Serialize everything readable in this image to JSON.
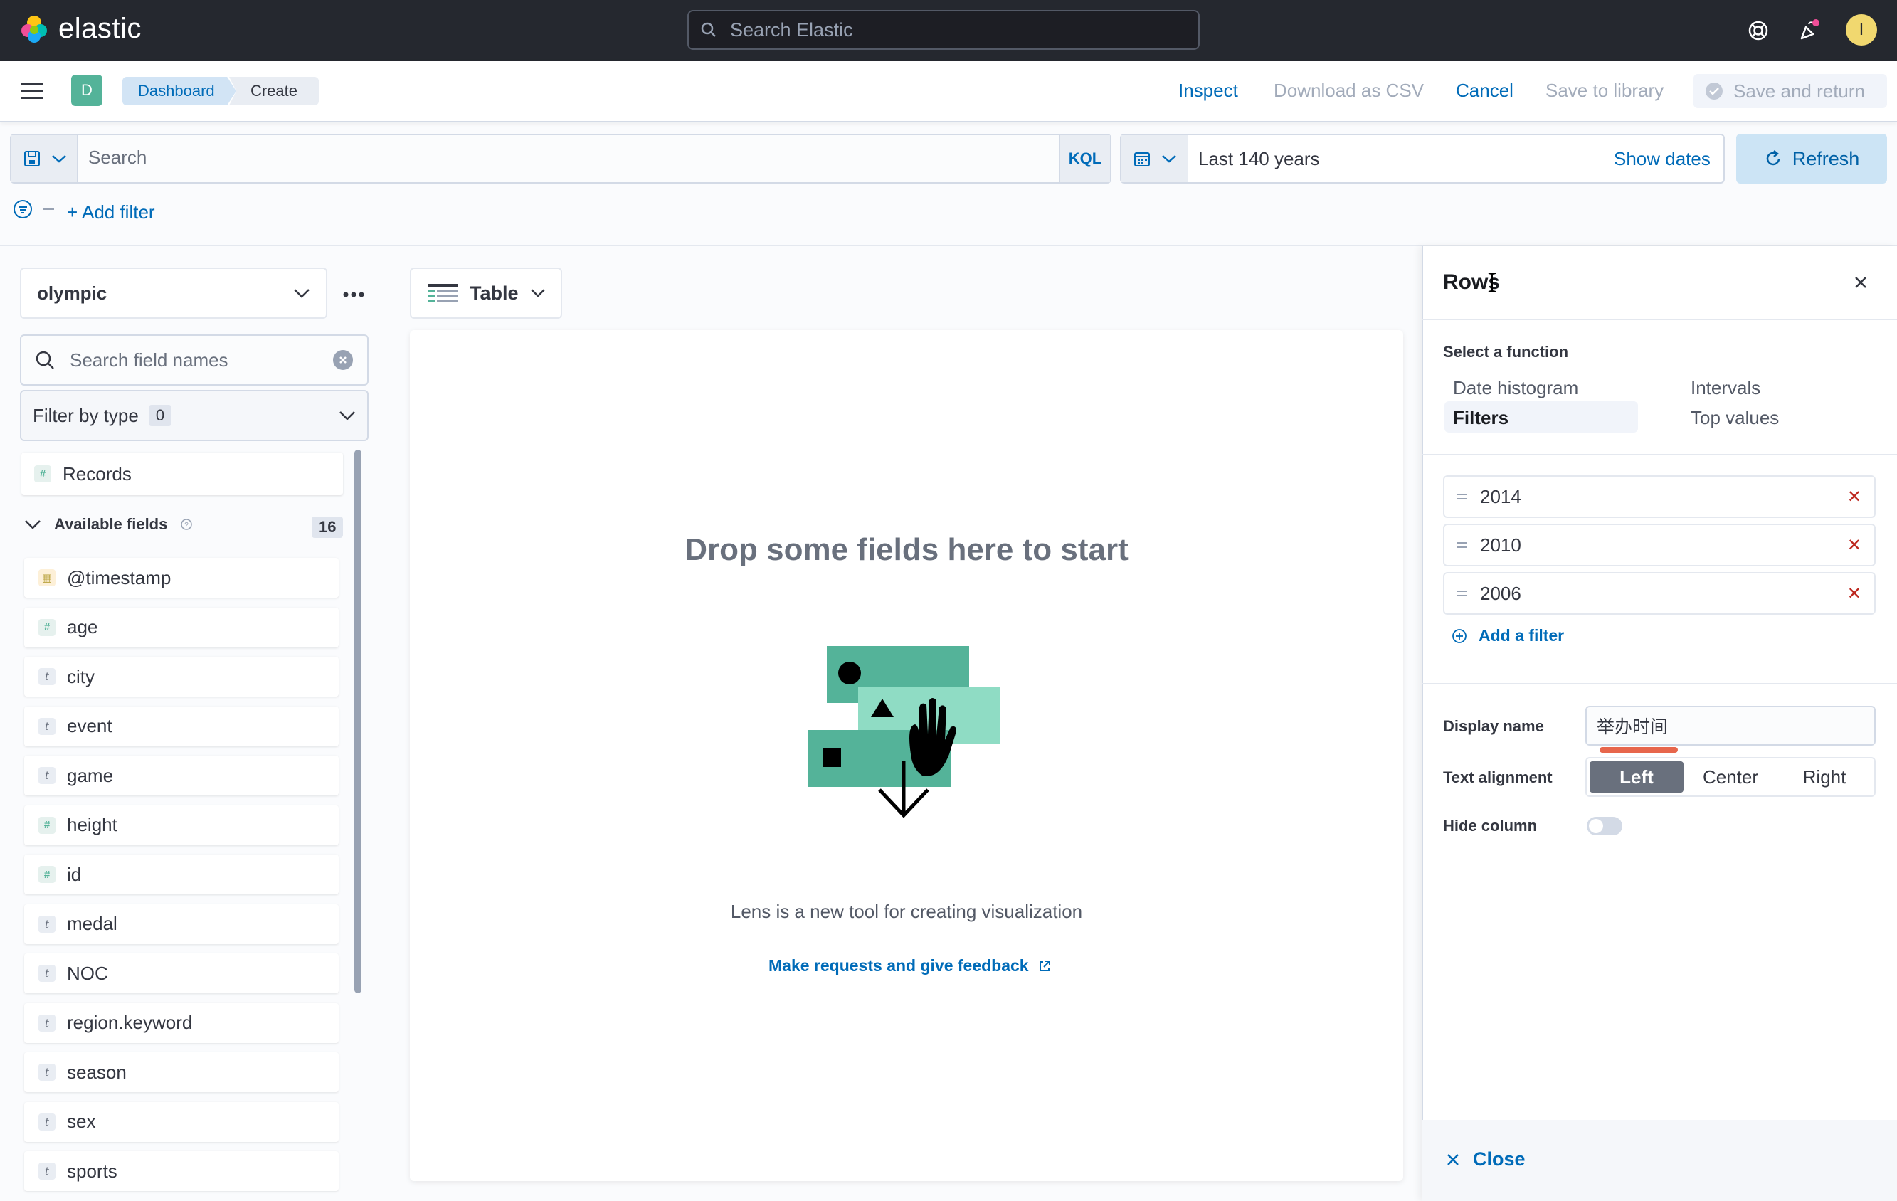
{
  "header": {
    "brand": "elastic",
    "search_placeholder": "Search Elastic",
    "avatar_initial": "I"
  },
  "appbar": {
    "space_badge": "D",
    "breadcrumbs": [
      "Dashboard",
      "Create"
    ],
    "actions": {
      "inspect": "Inspect",
      "download_csv": "Download as CSV",
      "cancel": "Cancel",
      "save_library": "Save to library",
      "save_return": "Save and return"
    }
  },
  "querybar": {
    "search_placeholder": "Search",
    "language": "KQL",
    "time_range": "Last 140 years",
    "show_dates": "Show dates",
    "refresh": "Refresh",
    "add_filter": "+ Add filter"
  },
  "sidebar": {
    "index_pattern": "olympic",
    "field_search_placeholder": "Search field names",
    "filter_by_type": "Filter by type",
    "filter_count": "0",
    "records_label": "Records",
    "available_fields_label": "Available fields",
    "available_count": "16",
    "fields": [
      {
        "name": "@timestamp",
        "type": "date"
      },
      {
        "name": "age",
        "type": "number"
      },
      {
        "name": "city",
        "type": "string"
      },
      {
        "name": "event",
        "type": "string"
      },
      {
        "name": "game",
        "type": "string"
      },
      {
        "name": "height",
        "type": "number"
      },
      {
        "name": "id",
        "type": "number"
      },
      {
        "name": "medal",
        "type": "string"
      },
      {
        "name": "NOC",
        "type": "string"
      },
      {
        "name": "region.keyword",
        "type": "string"
      },
      {
        "name": "season",
        "type": "string"
      },
      {
        "name": "sex",
        "type": "string"
      },
      {
        "name": "sports",
        "type": "string"
      }
    ]
  },
  "workspace": {
    "vis_type": "Table",
    "drop_title": "Drop some fields here to start",
    "description": "Lens is a new tool for creating visualization",
    "feedback_link": "Make requests and give feedback"
  },
  "flyout": {
    "title": "Rows",
    "select_function_label": "Select a function",
    "functions": [
      "Date histogram",
      "Intervals",
      "Filters",
      "Top values"
    ],
    "selected_function": "Filters",
    "filters": [
      "2014",
      "2010",
      "2006"
    ],
    "add_filter": "Add a filter",
    "display_name_label": "Display name",
    "display_name_value": "举办时间",
    "text_alignment_label": "Text alignment",
    "alignment_options": [
      "Left",
      "Center",
      "Right"
    ],
    "alignment_selected": "Left",
    "hide_column_label": "Hide column",
    "hide_column_on": false,
    "close": "Close"
  },
  "colors": {
    "header_bg": "#25282f",
    "link": "#006bb8",
    "accent_teal": "#54b399",
    "danger": "#bd271e"
  }
}
